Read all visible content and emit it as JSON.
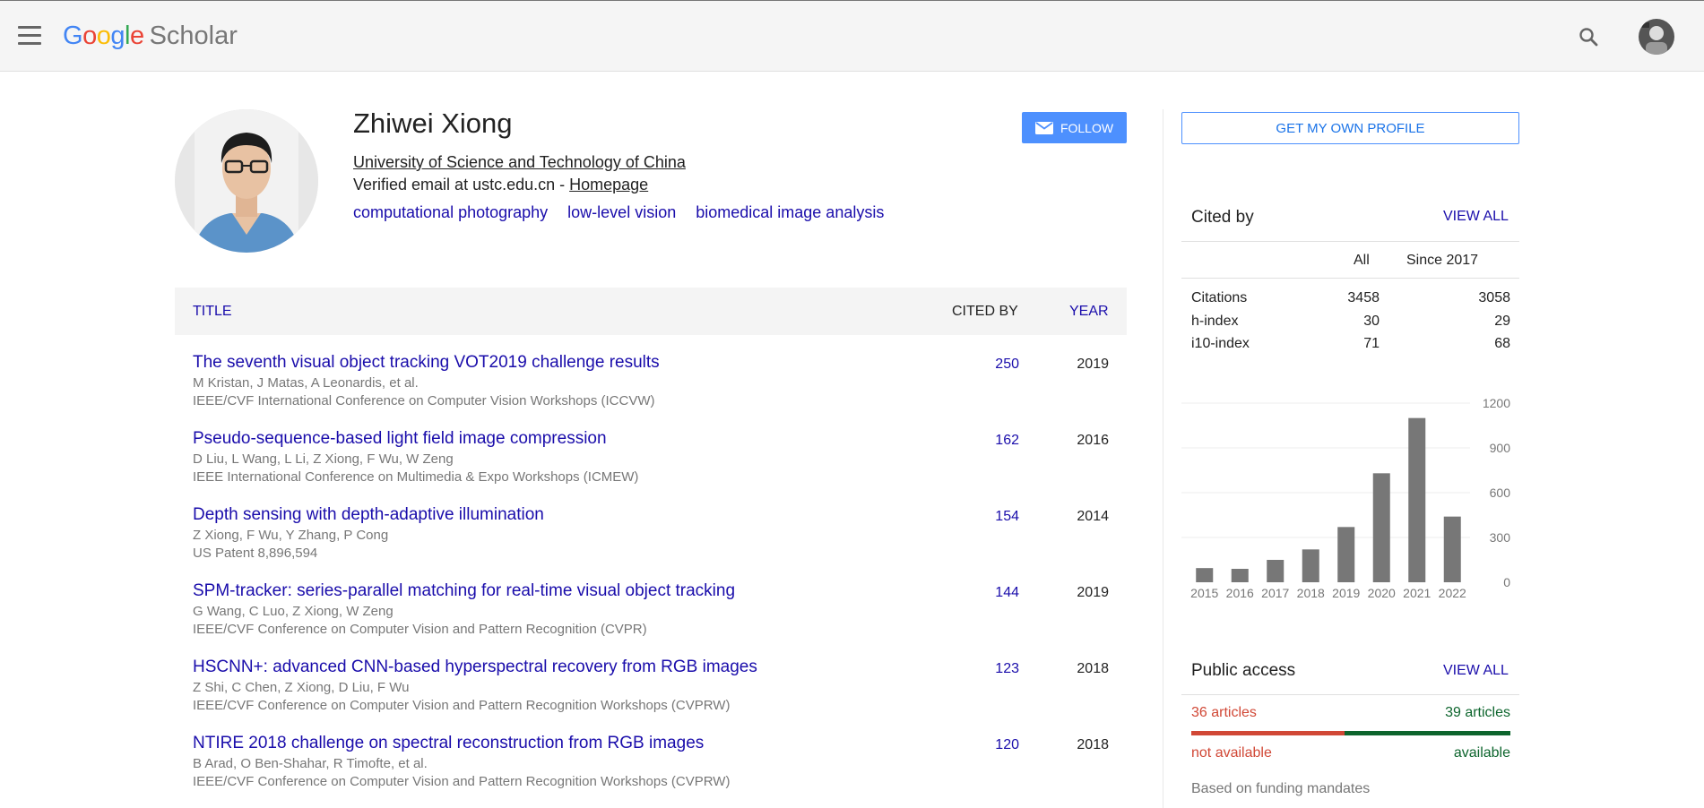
{
  "header": {
    "logo_google": "Google",
    "logo_scholar": "Scholar"
  },
  "profile": {
    "name": "Zhiwei Xiong",
    "affiliation": "University of Science and Technology of China",
    "email_prefix": "Verified email at ustc.edu.cn - ",
    "homepage": "Homepage",
    "interests": [
      "computational photography",
      "low-level vision",
      "biomedical image analysis"
    ],
    "follow_label": "FOLLOW"
  },
  "table": {
    "headers": {
      "title": "TITLE",
      "cited_by": "CITED BY",
      "year": "YEAR"
    },
    "rows": [
      {
        "title": "The seventh visual object tracking VOT2019 challenge results",
        "authors": "M Kristan, J Matas, A Leonardis, et al.",
        "venue": "IEEE/CVF International Conference on Computer Vision Workshops (ICCVW)",
        "cites": "250",
        "year": "2019"
      },
      {
        "title": "Pseudo-sequence-based light field image compression",
        "authors": "D Liu, L Wang, L Li, Z Xiong, F Wu, W Zeng",
        "venue": "IEEE International Conference on Multimedia & Expo Workshops (ICMEW)",
        "cites": "162",
        "year": "2016"
      },
      {
        "title": "Depth sensing with depth-adaptive illumination",
        "authors": "Z Xiong, F Wu, Y Zhang, P Cong",
        "venue": "US Patent 8,896,594",
        "cites": "154",
        "year": "2014"
      },
      {
        "title": "SPM-tracker: series-parallel matching for real-time visual object tracking",
        "authors": "G Wang, C Luo, Z Xiong, W Zeng",
        "venue": "IEEE/CVF Conference on Computer Vision and Pattern Recognition (CVPR)",
        "cites": "144",
        "year": "2019"
      },
      {
        "title": "HSCNN+: advanced CNN-based hyperspectral recovery from RGB images",
        "authors": "Z Shi, C Chen, Z Xiong, D Liu, F Wu",
        "venue": "IEEE/CVF Conference on Computer Vision and Pattern Recognition Workshops (CVPRW)",
        "cites": "123",
        "year": "2018"
      },
      {
        "title": "NTIRE 2018 challenge on spectral reconstruction from RGB images",
        "authors": "B Arad, O Ben-Shahar, R Timofte, et al.",
        "venue": "IEEE/CVF Conference on Computer Vision and Pattern Recognition Workshops (CVPRW)",
        "cites": "120",
        "year": "2018"
      }
    ]
  },
  "sidebar": {
    "own_profile_label": "GET MY OWN PROFILE",
    "cited_by_title": "Cited by",
    "view_all": "VIEW ALL",
    "col_all": "All",
    "col_since": "Since 2017",
    "stats": [
      {
        "label": "Citations",
        "all": "3458",
        "since": "3058"
      },
      {
        "label": "h-index",
        "all": "30",
        "since": "29"
      },
      {
        "label": "i10-index",
        "all": "71",
        "since": "68"
      }
    ],
    "public_access_title": "Public access",
    "public_access_view_all": "VIEW ALL",
    "not_available_count": "36 articles",
    "available_count": "39 articles",
    "not_available_fraction": 0.48,
    "not_available_label": "not available",
    "available_label": "available",
    "mandates_label": "Based on funding mandates",
    "colors": {
      "unavailable": "#d14836",
      "available": "#0d652d",
      "bar": "#777777"
    }
  },
  "chart_data": {
    "type": "bar",
    "categories": [
      "2015",
      "2016",
      "2017",
      "2018",
      "2019",
      "2020",
      "2021",
      "2022"
    ],
    "values": [
      95,
      90,
      150,
      220,
      370,
      730,
      1100,
      440
    ],
    "yticks": [
      0,
      300,
      600,
      900,
      1200
    ],
    "ylim": [
      0,
      1200
    ],
    "title": "",
    "xlabel": "",
    "ylabel": ""
  }
}
